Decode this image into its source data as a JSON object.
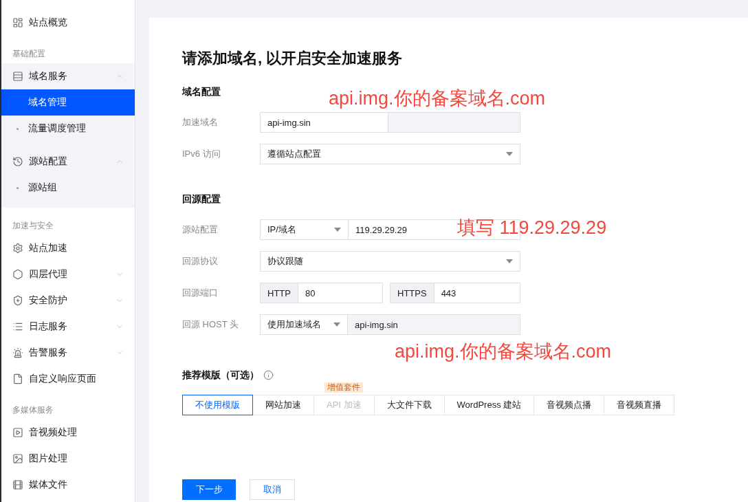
{
  "sidebar": {
    "items": [
      {
        "kind": "link",
        "label": "站点概览",
        "selected": false
      },
      {
        "kind": "group",
        "label": "基础配置"
      },
      {
        "kind": "menu",
        "label": "域名服务",
        "expanded": true,
        "children": [
          {
            "label": "域名管理",
            "selected": true
          },
          {
            "label": "流量调度管理",
            "selected": false
          }
        ]
      },
      {
        "kind": "menu",
        "label": "源站配置",
        "expanded": true,
        "children": [
          {
            "label": "源站组",
            "selected": false
          }
        ]
      },
      {
        "kind": "group",
        "label": "加速与安全"
      },
      {
        "kind": "link",
        "label": "站点加速",
        "selected": false
      },
      {
        "kind": "menu",
        "label": "四层代理",
        "expanded": false
      },
      {
        "kind": "menu",
        "label": "安全防护",
        "expanded": false
      },
      {
        "kind": "menu",
        "label": "日志服务",
        "expanded": false
      },
      {
        "kind": "menu",
        "label": "告警服务",
        "expanded": false
      },
      {
        "kind": "link",
        "label": "自定义响应页面",
        "selected": false
      },
      {
        "kind": "group",
        "label": "多媒体服务"
      },
      {
        "kind": "link",
        "label": "音视频处理",
        "selected": false
      },
      {
        "kind": "link",
        "label": "图片处理",
        "selected": false
      },
      {
        "kind": "link",
        "label": "媒体文件",
        "selected": false
      }
    ]
  },
  "title": "请添加域名, 以开启安全加速服务",
  "sections": [
    {
      "heading": "域名配置",
      "rows": [
        {
          "kind": "domain",
          "label": "加速域名",
          "value": "api-img.sin"
        },
        {
          "kind": "select",
          "label": "IPv6 访问",
          "value": "遵循站点配置"
        }
      ]
    },
    {
      "heading": "回源配置",
      "rows": [
        {
          "kind": "select_input",
          "label": "源站配置",
          "select": "IP/域名",
          "value": "119.29.29.29"
        },
        {
          "kind": "select",
          "label": "回源协议",
          "value": "协议跟随"
        },
        {
          "kind": "ports",
          "label": "回源端口",
          "ports": [
            {
              "protocol": "HTTP",
              "value": "80"
            },
            {
              "protocol": "HTTPS",
              "value": "443"
            }
          ]
        },
        {
          "kind": "select_readonly",
          "label": "回源 HOST 头",
          "select": "使用加速域名",
          "value": "api-img.sin"
        }
      ]
    }
  ],
  "templates": {
    "heading": "推荐模版（可选）",
    "tabs": [
      {
        "label": "不使用模版",
        "selected": true,
        "disabled": false
      },
      {
        "label": "网站加速",
        "selected": false,
        "disabled": false
      },
      {
        "label": "API 加速",
        "selected": false,
        "disabled": true,
        "badge": "增值套件"
      },
      {
        "label": "大文件下载",
        "selected": false,
        "disabled": false
      },
      {
        "label": "WordPress 建站",
        "selected": false,
        "disabled": false
      },
      {
        "label": "音视频点播",
        "selected": false,
        "disabled": false
      },
      {
        "label": "音视频直播",
        "selected": false,
        "disabled": false
      }
    ]
  },
  "buttons": [
    {
      "kind": "primary",
      "label": "下一步"
    },
    {
      "kind": "secondary",
      "label": "取消"
    }
  ],
  "annotations": [
    "api.img.你的备案域名.com",
    "填写 119.29.29.29",
    "api.img.你的备案域名.com"
  ]
}
